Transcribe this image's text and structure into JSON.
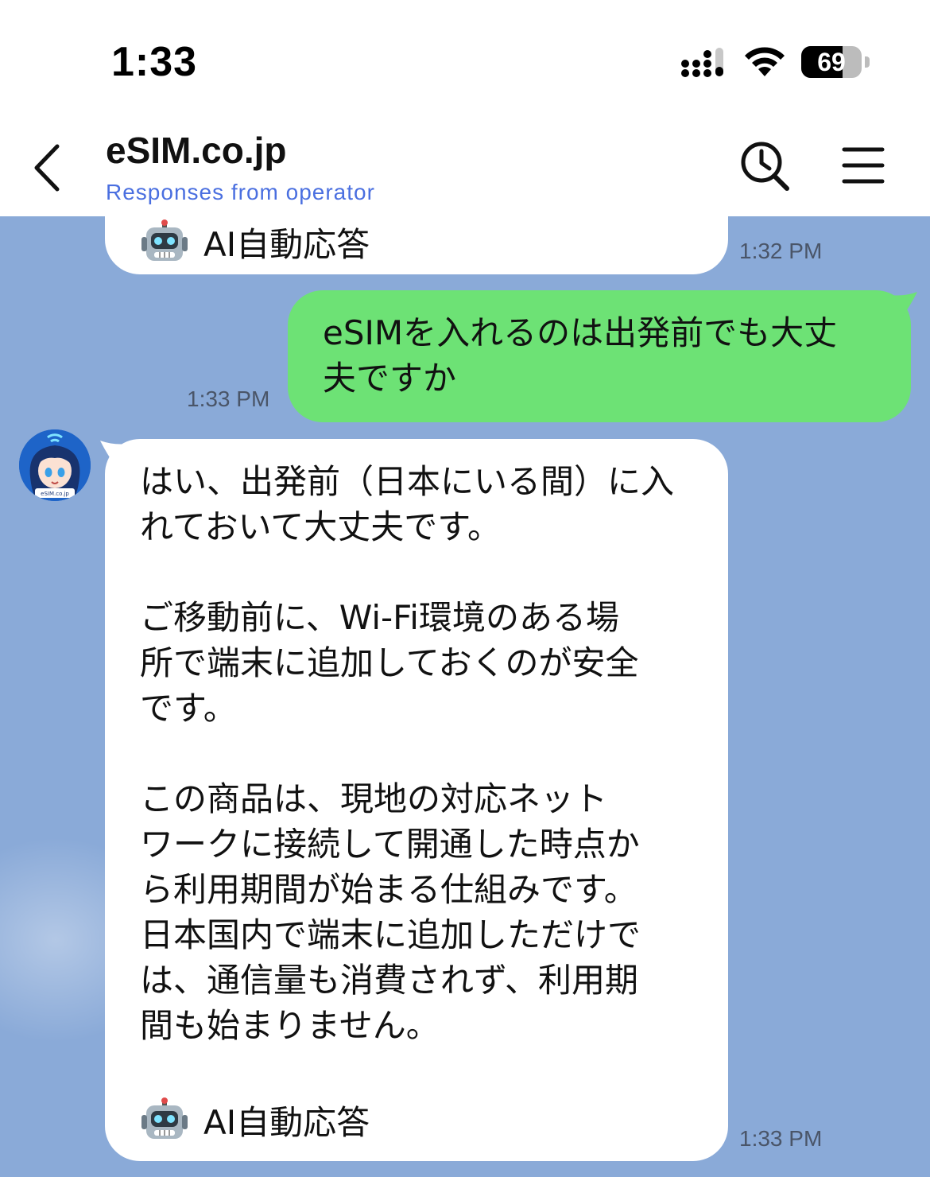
{
  "status_bar": {
    "time": "1:33",
    "battery_percent": 69,
    "battery_label": "69",
    "signal_bars_filled": 3,
    "icons": [
      "signal-icon",
      "wifi-icon",
      "battery-icon"
    ]
  },
  "header": {
    "title": "eSIM.co.jp",
    "subtitle": "Responses from operator",
    "back_icon": "chevron-left-icon",
    "search_icon": "clock-search-icon",
    "menu_icon": "hamburger-menu-icon",
    "subtitle_color": "#4a6fe0"
  },
  "chat": {
    "background_color": "#8aaad8",
    "messages": [
      {
        "direction": "incoming",
        "ai_tag": "AI自動応答",
        "ai_tag_icon": "robot-icon",
        "time": "1:32 PM"
      },
      {
        "direction": "outgoing",
        "text": "eSIMを入れるのは出発前でも大丈\n夫ですか",
        "time": "1:33 PM",
        "bubble_color": "#6de275"
      },
      {
        "direction": "incoming",
        "avatar": "operator-avatar",
        "paragraphs": [
          "はい、出発前（日本にいる間）に入\nれておいて大丈夫です。",
          "ご移動前に、Wi-Fi環境のある場\n所で端末に追加しておくのが安全\nです。",
          "この商品は、現地の対応ネット\nワークに接続して開通した時点か\nら利用期間が始まる仕組みです。\n日本国内で端末に追加しただけで\nは、通信量も消費されず、利用期\n間も始まりません。"
        ],
        "ai_tag": "AI自動応答",
        "ai_tag_icon": "robot-icon",
        "time": "1:33 PM",
        "avatar_label": "eSIM.co.jp"
      }
    ]
  }
}
